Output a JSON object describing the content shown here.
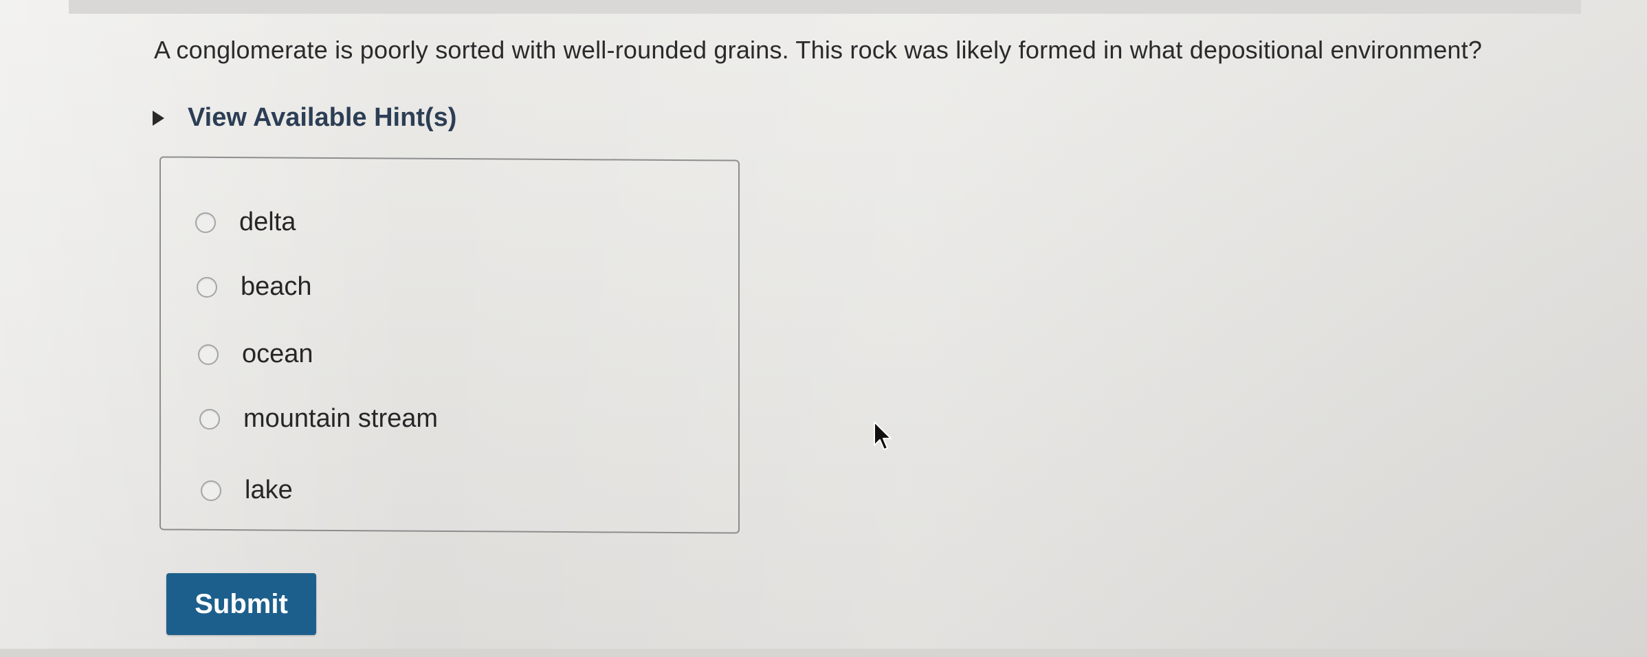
{
  "question": {
    "text": "A conglomerate is poorly sorted with well-rounded grains. This rock was likely formed in what depositional environment?"
  },
  "hint": {
    "label": "View Available Hint(s)",
    "icon": "disclosure-triangle-icon"
  },
  "options": [
    {
      "label": "delta"
    },
    {
      "label": "beach"
    },
    {
      "label": "ocean"
    },
    {
      "label": "mountain stream"
    },
    {
      "label": "lake"
    }
  ],
  "submit": {
    "label": "Submit",
    "color": "#1d5f8c"
  },
  "colors": {
    "accent": "#1d5f8c",
    "hint_text": "#2c3e55",
    "text": "#262626"
  }
}
